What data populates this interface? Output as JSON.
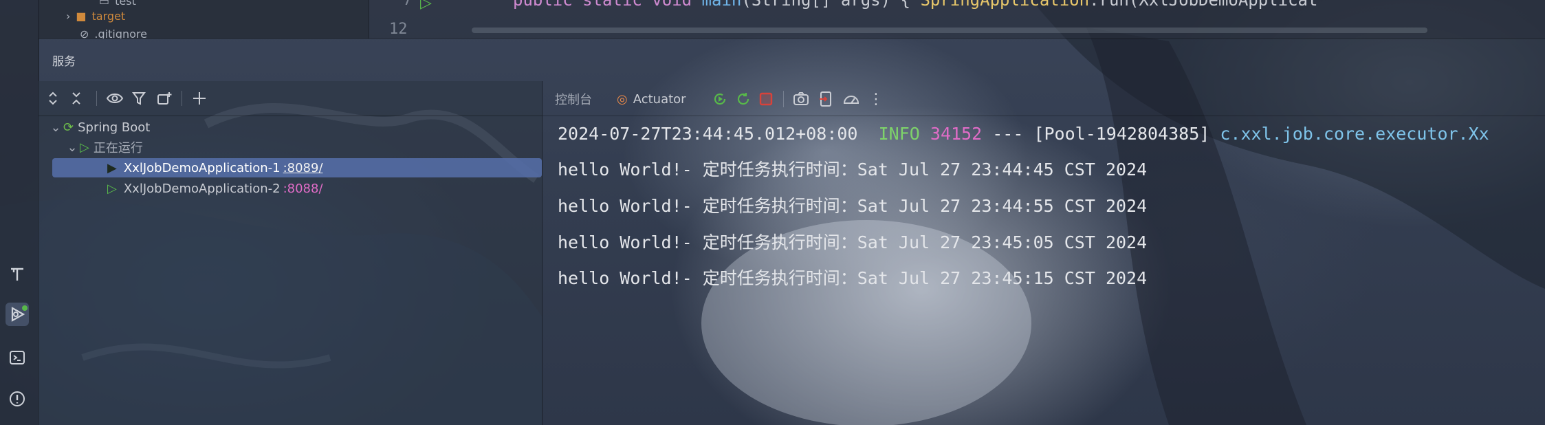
{
  "editor_fragment": {
    "tree_items": [
      "test",
      "target",
      ".gitignore"
    ],
    "line_numbers": [
      "7",
      "12"
    ],
    "code_line": {
      "keywords": "public static void",
      "method": "main",
      "params": "(String[] args) { ",
      "class_call": "SpringApplication",
      "run": ".run(",
      "arg": "XxlJobDemoApplicat"
    }
  },
  "services": {
    "title": "服务",
    "tree": {
      "root": "Spring Boot",
      "group": "正在运行",
      "apps": [
        {
          "name": "XxlJobDemoApplication-1",
          "port": ":8089/",
          "selected": true
        },
        {
          "name": "XxlJobDemoApplication-2",
          "port": ":8088/",
          "selected": false
        }
      ]
    }
  },
  "console": {
    "tabs": {
      "console": "控制台",
      "actuator": "Actuator"
    },
    "log_header": {
      "timestamp": "2024-07-27T23:44:45.012+08:00",
      "level": "INFO",
      "pid": "34152",
      "sep": "---",
      "thread": "[Pool-1942804385]",
      "logger": "c.xxl.job.core.executor.Xx"
    },
    "lines": [
      "hello World!- 定时任务执行时间：Sat Jul 27 23:44:45 CST 2024",
      "hello World!- 定时任务执行时间：Sat Jul 27 23:44:55 CST 2024",
      "hello World!- 定时任务执行时间：Sat Jul 27 23:45:05 CST 2024",
      "hello World!- 定时任务执行时间：Sat Jul 27 23:45:15 CST 2024"
    ]
  },
  "colors": {
    "info": "#7ed36a",
    "pid": "#e06cc7",
    "logger": "#7fc4ea",
    "selection": "#5670aa",
    "running": "#58b84a",
    "stop": "#d9423a"
  },
  "icons": [
    "tool-icon",
    "services-icon",
    "terminal-icon",
    "problems-icon",
    "expand-all-icon",
    "collapse-all-icon",
    "eye-icon",
    "filter-icon",
    "new-group-icon",
    "add-icon",
    "actuator-icon",
    "restart-icon",
    "rerun-icon",
    "stop-icon",
    "camera-icon",
    "exit-icon",
    "gauge-icon",
    "more-icon"
  ]
}
